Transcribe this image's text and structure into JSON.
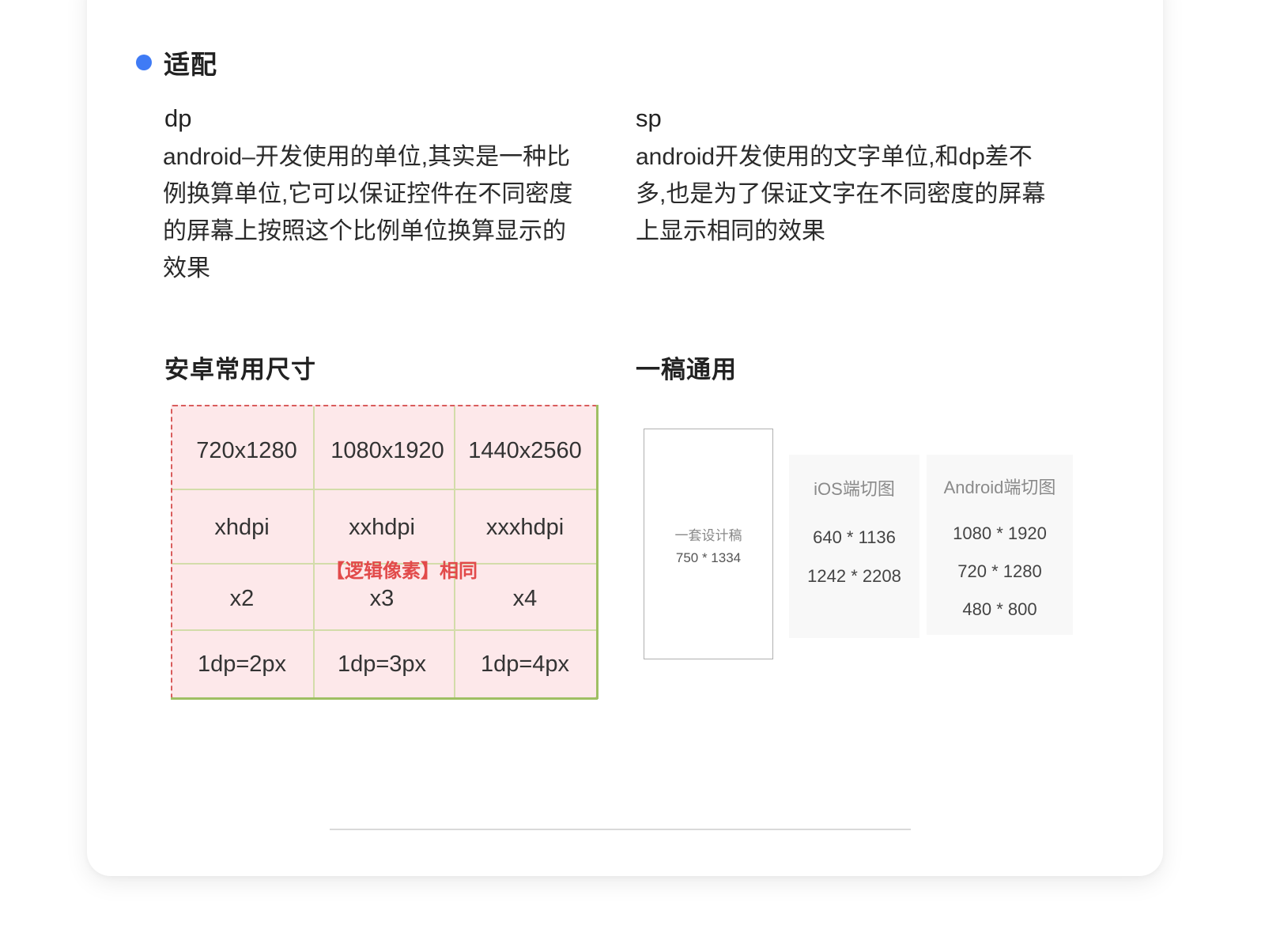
{
  "section": {
    "title": "适配"
  },
  "dp": {
    "term": "dp",
    "lines": [
      "android–开发使用的单位,其实是一种比",
      "例换算单位,它可以保证控件在不同密度",
      "的屏幕上按照这个比例单位换算显示的",
      "效果"
    ]
  },
  "sp": {
    "term": "sp",
    "lines": [
      "android开发使用的文字单位,和dp差不",
      "多,也是为了保证文字在不同密度的屏幕",
      "上显示相同的效果"
    ]
  },
  "android_sizes": {
    "title": "安卓常用尺寸",
    "rows": [
      [
        "720x1280",
        "1080x1920",
        "1440x2560"
      ],
      [
        "xhdpi",
        "xxhdpi",
        "xxxhdpi"
      ],
      [
        "x2",
        "x3",
        "x4"
      ],
      [
        "1dp=2px",
        "1dp=3px",
        "1dp=4px"
      ]
    ],
    "overlay": "【逻辑像素】相同"
  },
  "universal": {
    "title": "一稿通用",
    "design": {
      "label": "一套设计稿",
      "size": "750 * 1334"
    },
    "ios": {
      "title": "iOS端切图",
      "sizes": [
        "640 * 1136",
        "1242 * 2208"
      ]
    },
    "android": {
      "title": "Android端切图",
      "sizes": [
        "1080 * 1920",
        "720 * 1280",
        "480 * 800"
      ]
    }
  },
  "colors": {
    "accent": "#3f7bf5",
    "overlay_red": "#e24a4a",
    "table_bg": "#fde8ea"
  }
}
